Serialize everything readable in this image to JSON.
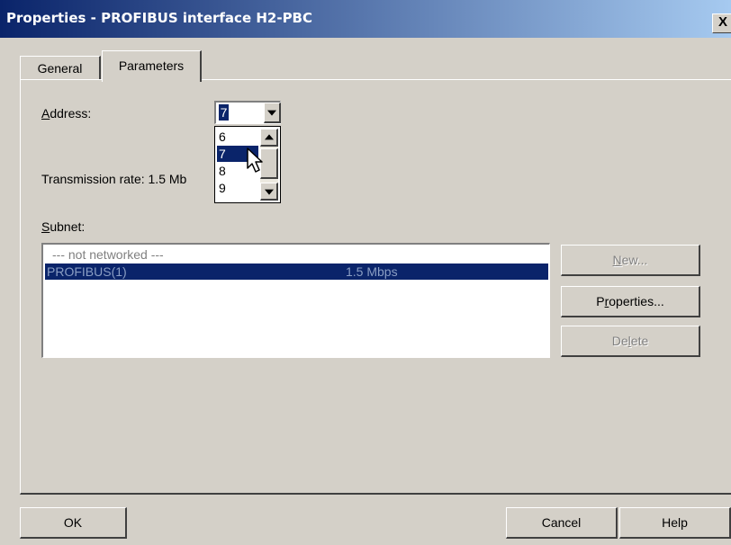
{
  "window": {
    "title": "Properties - PROFIBUS interface  H2-PBC",
    "close_label": "X"
  },
  "tabs": [
    {
      "label": "General"
    },
    {
      "label": "Parameters"
    }
  ],
  "parameters": {
    "address_label": "Address:",
    "address_value": "7",
    "address_options": [
      "6",
      "7",
      "8",
      "9"
    ],
    "transmission_rate_label": "Transmission rate: 1.5 Mb",
    "subnet_label": "Subnet:",
    "subnet_rows": [
      {
        "name": "--- not networked ---",
        "rate": ""
      },
      {
        "name": "PROFIBUS(1)",
        "rate": "1.5 Mbps"
      }
    ]
  },
  "buttons": {
    "new": "New...",
    "properties": "Properties...",
    "delete": "Delete",
    "ok": "OK",
    "cancel": "Cancel",
    "help": "Help"
  },
  "colors": {
    "selection": "#0a246a",
    "dialog_bg": "#d4d0c8"
  },
  "icons": {
    "dropdown": "chevron-down-icon",
    "scroll_up": "scroll-up-icon",
    "scroll_down": "scroll-down-icon",
    "cursor": "mouse-pointer-icon"
  }
}
